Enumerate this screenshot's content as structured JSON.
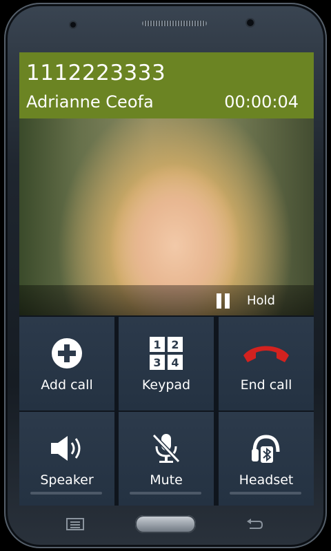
{
  "call": {
    "number": "1112223333",
    "name": "Adrianne Ceofa",
    "duration": "00:00:04",
    "hold_label": "Hold"
  },
  "actions": [
    {
      "label": "Add call",
      "icon": "add-circle-icon"
    },
    {
      "label": "Keypad",
      "icon": "keypad-icon",
      "keys": [
        "1",
        "2",
        "3",
        "4"
      ]
    },
    {
      "label": "End call",
      "icon": "end-call-icon"
    },
    {
      "label": "Speaker",
      "icon": "speaker-icon"
    },
    {
      "label": "Mute",
      "icon": "mute-mic-icon"
    },
    {
      "label": "Headset",
      "icon": "bluetooth-headset-icon"
    }
  ],
  "colors": {
    "header": "#6b8423",
    "button_bg": "#2c3a4b",
    "end_call": "#d3221f"
  },
  "hardware": {
    "left_key_icon": "menu-icon",
    "right_key_icon": "back-icon"
  }
}
